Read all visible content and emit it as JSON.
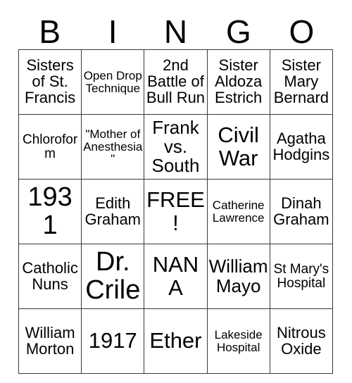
{
  "card": {
    "header_letters": [
      "B",
      "I",
      "N",
      "G",
      "O"
    ],
    "rows": [
      [
        {
          "text": "Sisters of St. Francis",
          "size": "lg"
        },
        {
          "text": "Open Drop Technique",
          "size": "sm"
        },
        {
          "text": "2nd Battle of Bull Run",
          "size": "lg"
        },
        {
          "text": "Sister Aldoza Estrich",
          "size": "lg"
        },
        {
          "text": "Sister Mary Bernard",
          "size": "lg"
        }
      ],
      [
        {
          "text": "Chloroform",
          "size": "md"
        },
        {
          "text": "\"Mother of Anesthesia\"",
          "size": "sm"
        },
        {
          "text": "Frank vs. South",
          "size": "xl"
        },
        {
          "text": "Civil War",
          "size": "xxl"
        },
        {
          "text": "Agatha Hodgins",
          "size": "lg"
        }
      ],
      [
        {
          "text": "1931",
          "size": "huge"
        },
        {
          "text": "Edith Graham",
          "size": "lg"
        },
        {
          "text": "FREE!",
          "size": "xxl"
        },
        {
          "text": "Catherine Lawrence",
          "size": "sm"
        },
        {
          "text": "Dinah Graham",
          "size": "lg"
        }
      ],
      [
        {
          "text": "Catholic Nuns",
          "size": "lg"
        },
        {
          "text": "Dr. Crile",
          "size": "huge"
        },
        {
          "text": "NANA",
          "size": "xxl"
        },
        {
          "text": "William Mayo",
          "size": "xl"
        },
        {
          "text": "St Mary's Hospital",
          "size": "md"
        }
      ],
      [
        {
          "text": "William Morton",
          "size": "lg"
        },
        {
          "text": "1917",
          "size": "xxl"
        },
        {
          "text": "Ether",
          "size": "xxl"
        },
        {
          "text": "Lakeside Hospital",
          "size": "sm"
        },
        {
          "text": "Nitrous Oxide",
          "size": "lg"
        }
      ]
    ],
    "free_space": {
      "row": 2,
      "col": 2,
      "label": "FREE!"
    }
  },
  "colors": {
    "background": "#ffffff",
    "text": "#000000",
    "border": "#3a3a3a"
  }
}
